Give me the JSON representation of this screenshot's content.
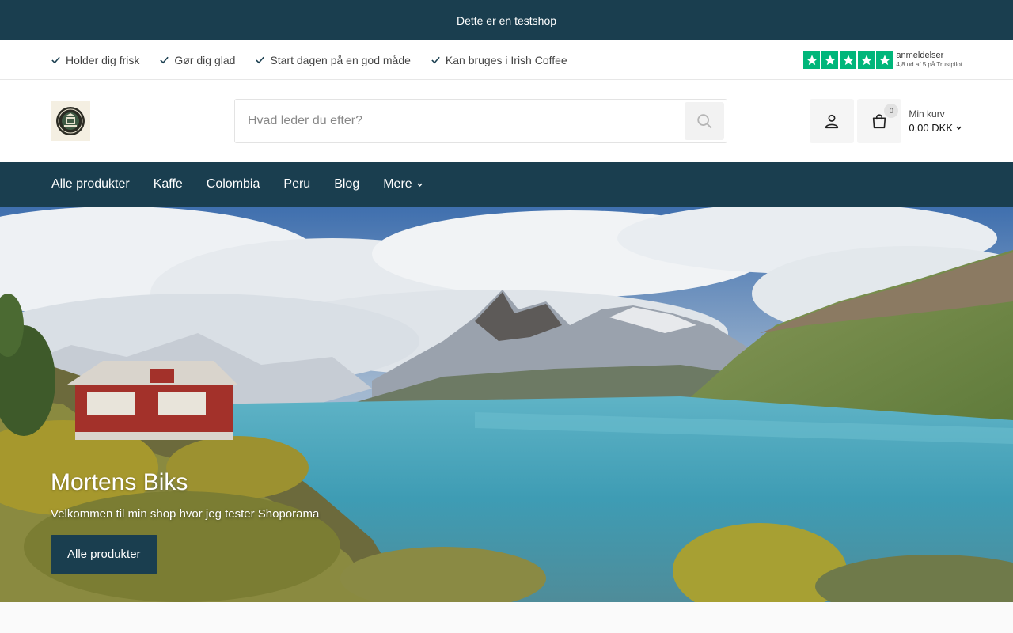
{
  "topbar": {
    "text": "Dette er en testshop"
  },
  "usps": [
    {
      "label": "Holder dig frisk",
      "icon": "check-icon"
    },
    {
      "label": "Gør dig glad",
      "icon": "check-icon"
    },
    {
      "label": "Start dagen på en god måde",
      "icon": "check-icon"
    },
    {
      "label": "Kan bruges i Irish Coffee",
      "icon": "check-icon"
    }
  ],
  "trustpilot": {
    "title": "anmeldelser",
    "subtitle": "4,8 ud af 5 på Trustpilot",
    "stars": 5,
    "color": "#00b67a"
  },
  "search": {
    "placeholder": "Hvad leder du efter?"
  },
  "cart": {
    "count": "0",
    "label": "Min kurv",
    "total": "0,00 DKK"
  },
  "nav": {
    "items": [
      {
        "label": "Alle produkter"
      },
      {
        "label": "Kaffe"
      },
      {
        "label": "Colombia"
      },
      {
        "label": "Peru"
      },
      {
        "label": "Blog"
      },
      {
        "label": "Mere"
      }
    ]
  },
  "hero": {
    "title": "Mortens Biks",
    "subtitle": "Velkommen til min shop hvor jeg tester Shoporama",
    "button": "Alle produkter"
  },
  "colors": {
    "brand": "#1a3e4f",
    "trustpilot": "#00b67a"
  }
}
